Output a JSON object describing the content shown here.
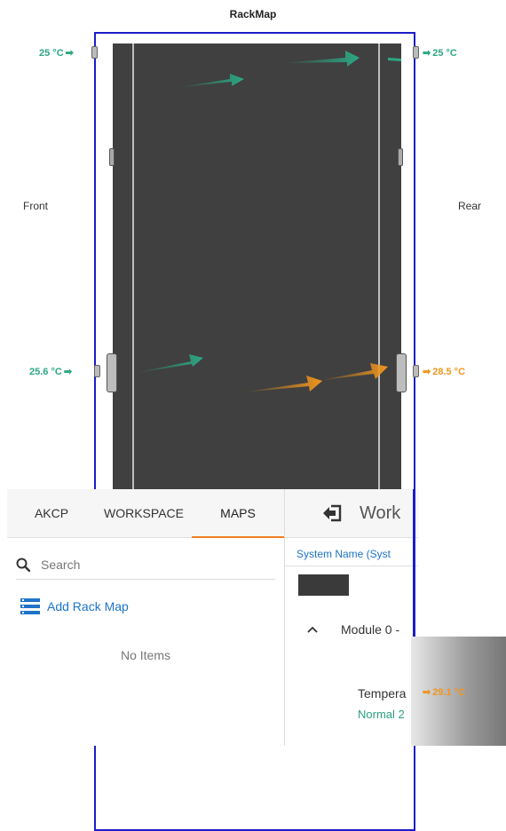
{
  "rackmap": {
    "title": "RackMap",
    "front_label": "Front",
    "rear_label": "Rear",
    "temps": {
      "front_top": "25 °C",
      "rear_top": "25 °C",
      "front_mid": "25.6 °C",
      "rear_mid": "28.5 °C",
      "rear_bottom": "29.1 °C"
    },
    "colors": {
      "frame": "#1d1dc8",
      "rack": "#404040",
      "cool": "#2ba882",
      "warm": "#f0951e"
    }
  },
  "left_panel": {
    "tabs": [
      "AKCP",
      "WORKSPACE",
      "MAPS"
    ],
    "active_tab": "MAPS",
    "search_placeholder": "Search",
    "add_rack_label": "Add Rack Map",
    "empty_text": "No Items"
  },
  "right_panel": {
    "title": "Work",
    "system_name_label": "System Name (Syst",
    "module_label": "Module 0 -",
    "sensor_label": "Tempera",
    "sensor_status": "Normal 2"
  }
}
